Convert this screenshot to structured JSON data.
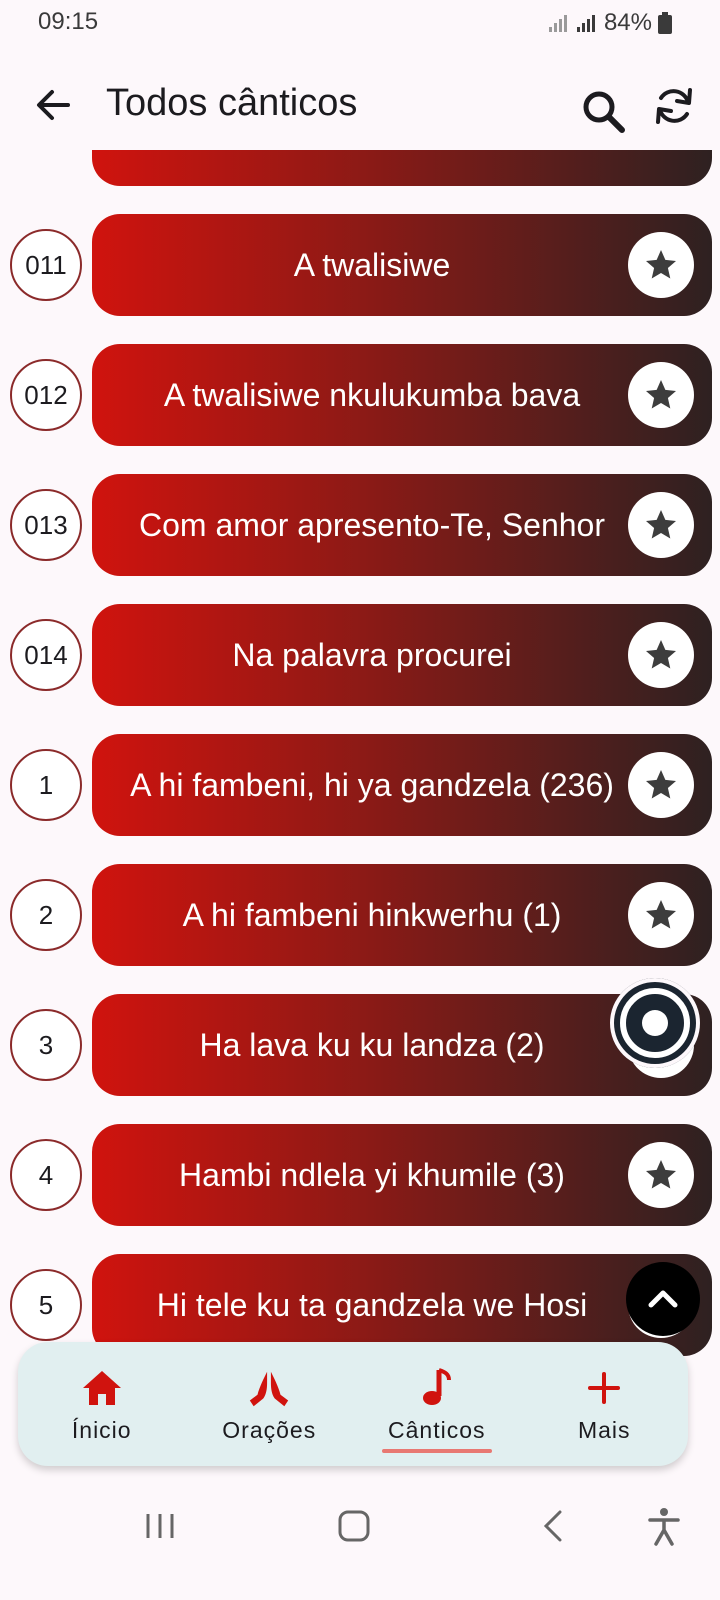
{
  "status": {
    "time": "09:15",
    "battery": "84%"
  },
  "header": {
    "title": "Todos cânticos"
  },
  "songs": [
    {
      "number": "011",
      "title": "A twalisiwe"
    },
    {
      "number": "012",
      "title": "A twalisiwe nkulukumba bava"
    },
    {
      "number": "013",
      "title": "Com amor apresento-Te, Senhor"
    },
    {
      "number": "014",
      "title": "Na palavra procurei"
    },
    {
      "number": "1",
      "title": "A hi fambeni, hi ya gandzela (236)"
    },
    {
      "number": "2",
      "title": "A hi fambeni hinkwerhu (1)"
    },
    {
      "number": "3",
      "title": "Ha lava ku ku landza (2)"
    },
    {
      "number": "4",
      "title": "Hambi ndlela yi khumile (3)"
    },
    {
      "number": "5",
      "title": "Hi tele ku ta gandzela we Hosi"
    }
  ],
  "nav": {
    "items": [
      {
        "label": "Ínicio",
        "icon": "home-icon"
      },
      {
        "label": "Orações",
        "icon": "praying-hands-icon"
      },
      {
        "label": "Cânticos",
        "icon": "music-note-icon",
        "active": true
      },
      {
        "label": "Mais",
        "icon": "plus-icon"
      }
    ]
  },
  "colors": {
    "accent": "#d0130e",
    "card_dark": "#2e2121",
    "nav_bg": "#e1eff0",
    "active_underline": "#e87872"
  }
}
